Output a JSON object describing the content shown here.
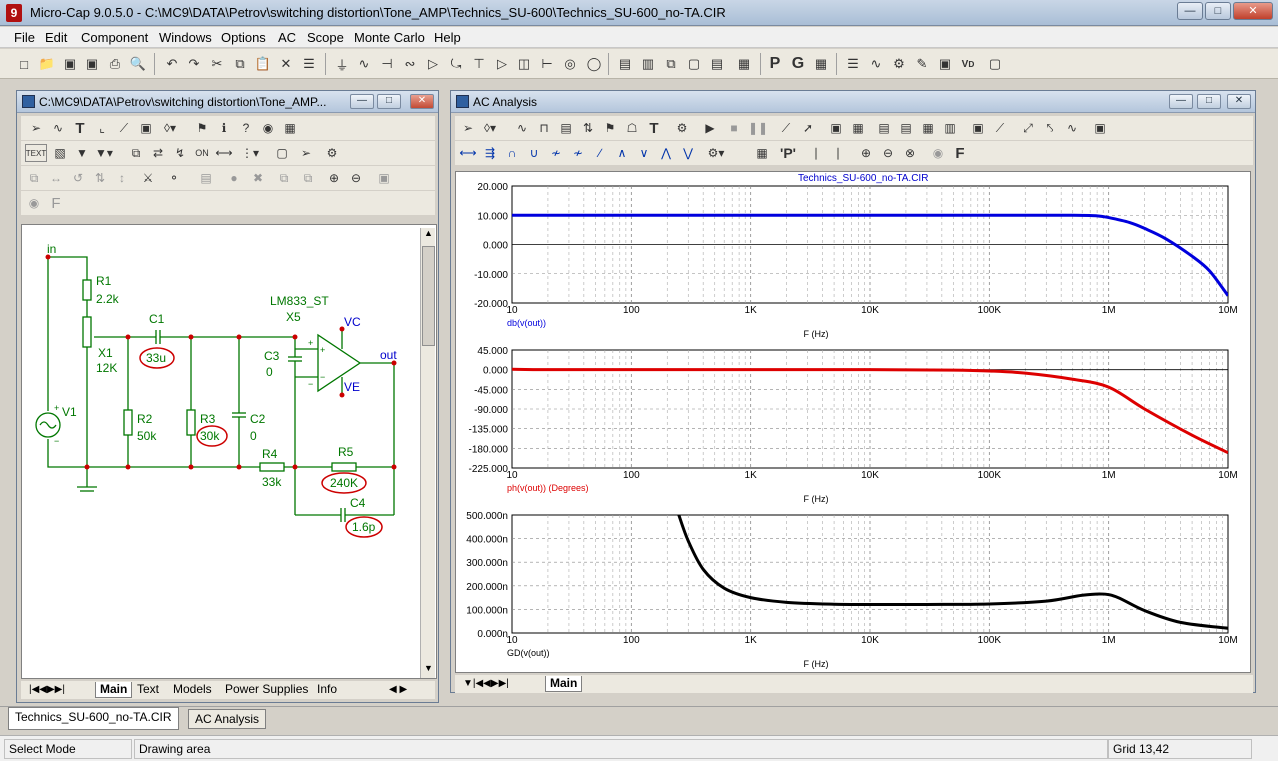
{
  "app": {
    "title": "Micro-Cap 9.0.5.0 - C:\\MC9\\DATA\\Petrov\\switching distortion\\Tone_AMP\\Technics_SU-600\\Technics_SU-600_no-TA.CIR",
    "icon_letter": "9"
  },
  "menu": [
    "File",
    "Edit",
    "Component",
    "Windows",
    "Options",
    "AC",
    "Scope",
    "Monte Carlo",
    "Help"
  ],
  "schematic_window": {
    "title": "C:\\MC9\\DATA\\Petrov\\switching distortion\\Tone_AMP...",
    "tabs": [
      "Main",
      "Text",
      "Models",
      "Power Supplies",
      "Info"
    ],
    "labels": {
      "in": "in",
      "out": "out",
      "R1": "R1",
      "R1v": "2.2k",
      "X1": "X1",
      "X1v": "12K",
      "C1": "C1",
      "C1v": "33u",
      "R2": "R2",
      "R2v": "50k",
      "R3": "R3",
      "R3v": "30k",
      "C2": "C2",
      "C2v": "0",
      "C3": "C3",
      "C3v": "0",
      "R4": "R4",
      "R4v": "33k",
      "R5": "R5",
      "R5v": "240K",
      "C4": "C4",
      "C4v": "1.6p",
      "V1": "V1",
      "opamp": "LM833_ST",
      "opamp_ref": "X5",
      "VC": "VC",
      "VE": "VE"
    },
    "highlight_color": "#cc0000",
    "label_color": "#007700"
  },
  "ac_window": {
    "title": "AC Analysis",
    "tab": "Main",
    "chart_title": "Technics_SU-600_no-TA.CIR",
    "x_ticks": [
      "10",
      "100",
      "1K",
      "10K",
      "100K",
      "1M",
      "10M"
    ],
    "x_label": "F (Hz)"
  },
  "chart_data": [
    {
      "type": "line",
      "title": "Technics_SU-600_no-TA.CIR",
      "ylabel": "db(v(out))",
      "xlabel": "F (Hz)",
      "xscale": "log",
      "xlim": [
        10,
        10000000
      ],
      "ylim": [
        -20,
        20
      ],
      "yticks": [
        "20.000",
        "10.000",
        "0.000",
        "-10.000",
        "-20.000"
      ],
      "color": "#0000dd",
      "x": [
        10,
        100,
        1000,
        10000,
        100000,
        500000,
        800000,
        1000000,
        1500000,
        2000000,
        3000000,
        5000000,
        7000000,
        10000000
      ],
      "y": [
        10,
        10,
        10,
        10,
        10,
        10,
        9.8,
        9.2,
        7.5,
        5.5,
        2,
        -4,
        -9,
        -17.5
      ]
    },
    {
      "type": "line",
      "ylabel": "ph(v(out)) (Degrees)",
      "xlabel": "F (Hz)",
      "xscale": "log",
      "xlim": [
        10,
        10000000
      ],
      "ylim": [
        -225,
        45
      ],
      "yticks": [
        "45.000",
        "0.000",
        "-45.000",
        "-90.000",
        "-135.000",
        "-180.000",
        "-225.000"
      ],
      "color": "#dd0000",
      "x": [
        10,
        20,
        100,
        1000,
        10000,
        50000,
        100000,
        200000,
        500000,
        1000000,
        2000000,
        5000000,
        10000000
      ],
      "y": [
        1,
        0,
        0,
        0,
        0,
        -1,
        -3,
        -8,
        -22,
        -40,
        -90,
        -150,
        -190
      ]
    },
    {
      "type": "line",
      "ylabel": "GD(v(out))",
      "xlabel": "F (Hz)",
      "xscale": "log",
      "xlim": [
        10,
        10000000
      ],
      "ylim": [
        0,
        500
      ],
      "yticks": [
        "500.000n",
        "400.000n",
        "300.000n",
        "200.000n",
        "100.000n",
        "0.000n"
      ],
      "color": "#000000",
      "x": [
        250,
        300,
        400,
        600,
        1000,
        2000,
        5000,
        10000,
        30000,
        100000,
        300000,
        600000,
        900000,
        1200000,
        2000000,
        4000000,
        10000000
      ],
      "y": [
        500,
        390,
        270,
        190,
        150,
        130,
        122,
        121,
        121,
        123,
        135,
        160,
        165,
        150,
        95,
        45,
        20
      ]
    }
  ],
  "doc_tabs": [
    "Technics_SU-600_no-TA.CIR",
    "AC Analysis"
  ],
  "status": {
    "mode": "Select Mode",
    "area": "Drawing area",
    "grid": "Grid 13,42"
  }
}
